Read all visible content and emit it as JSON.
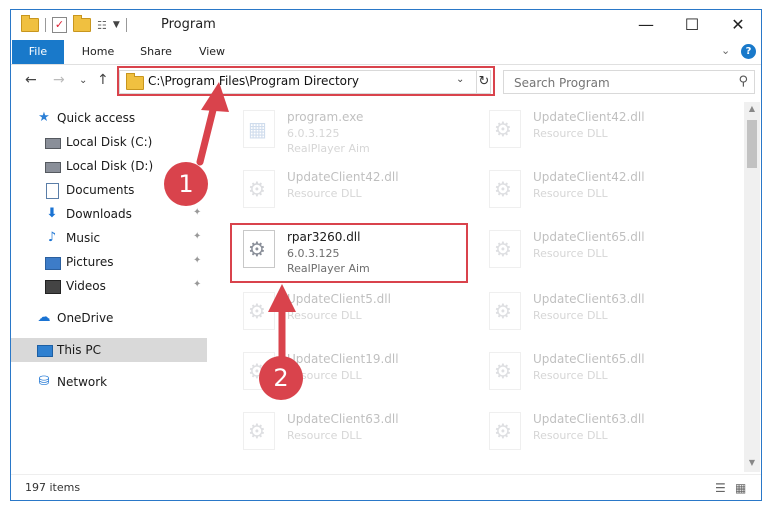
{
  "window": {
    "title": "Program",
    "minimize_label": "—",
    "maximize_label": "☐",
    "close_label": "✕"
  },
  "ribbon": {
    "tabs": [
      {
        "label": "File"
      },
      {
        "label": "Home"
      },
      {
        "label": "Share"
      },
      {
        "label": "View"
      }
    ],
    "expand_icon": "⌄",
    "help_icon": "?"
  },
  "nav": {
    "back": "←",
    "forward": "→",
    "history": "⌄",
    "up": "↑",
    "address": "C:\\Program Files\\Program Directory",
    "address_chevron": "⌄",
    "refresh": "↻",
    "search_placeholder": "Search Program",
    "search_icon": "⚲"
  },
  "sidebar": {
    "items": [
      {
        "label": "Quick access"
      },
      {
        "label": "Local Disk (C:)"
      },
      {
        "label": "Local Disk (D:)"
      },
      {
        "label": "Documents"
      },
      {
        "label": "Downloads"
      },
      {
        "label": "Music"
      },
      {
        "label": "Pictures"
      },
      {
        "label": "Videos"
      },
      {
        "label": "OneDrive"
      },
      {
        "label": "This PC"
      },
      {
        "label": "Network"
      }
    ],
    "pin": "📌"
  },
  "files": [
    {
      "name": "program.exe",
      "line2": "6.0.3.125",
      "line3": "RealPlayer Aim"
    },
    {
      "name": "UpdateClient42.dll",
      "line2": "Resource DLL"
    },
    {
      "name": "UpdateClient42.dll",
      "line2": "Resource DLL"
    },
    {
      "name": "UpdateClient42.dll",
      "line2": "Resource DLL"
    },
    {
      "name": "rpar3260.dll",
      "line2": "6.0.3.125",
      "line3": "RealPlayer Aim"
    },
    {
      "name": "UpdateClient65.dll",
      "line2": "Resource DLL"
    },
    {
      "name": "UpdateClient5.dll",
      "line2": "Resource DLL"
    },
    {
      "name": "UpdateClient63.dll",
      "line2": "Resource DLL"
    },
    {
      "name": "UpdateClient19.dll",
      "line2": "Resource DLL"
    },
    {
      "name": "UpdateClient65.dll",
      "line2": "Resource DLL"
    },
    {
      "name": "UpdateClient63.dll",
      "line2": "Resource DLL"
    },
    {
      "name": "UpdateClient63.dll",
      "line2": "Resource DLL"
    }
  ],
  "status": {
    "count": "197 items",
    "details_view_icon": "☰",
    "tiles_view_icon": "▦"
  },
  "annotations": {
    "step1": "1",
    "step2": "2",
    "accent": "#d9434c"
  }
}
